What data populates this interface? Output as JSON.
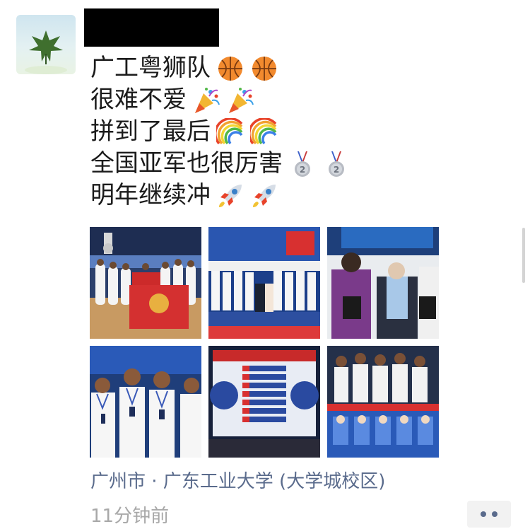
{
  "post": {
    "author_name_redacted": true,
    "lines": [
      {
        "text": "广工粤狮队",
        "emoji": "basketball-emoji"
      },
      {
        "text": "很难不爱",
        "emoji": "party-popper-emoji"
      },
      {
        "text": "拼到了最后",
        "emoji": "rainbow-emoji"
      },
      {
        "text": "全国亚军也很厉害",
        "emoji": "second-place-medal-emoji"
      },
      {
        "text": "明年继续冲",
        "emoji": "rocket-emoji"
      }
    ],
    "photos": [
      {
        "name": "photo-team-with-banner"
      },
      {
        "name": "photo-award-ceremony-stage"
      },
      {
        "name": "photo-plaque-presentation"
      },
      {
        "name": "photo-players-with-medals"
      },
      {
        "name": "photo-scoreboard-stats"
      },
      {
        "name": "photo-players-screen"
      }
    ],
    "location": "广州市 · 广东工业大学 (大学城校区)",
    "timestamp": "11分钟前"
  },
  "colors": {
    "text": "#1b1b1b",
    "link": "#5a6b8c",
    "meta": "#a8a8a8",
    "more_button_bg": "#f2f2f2"
  }
}
